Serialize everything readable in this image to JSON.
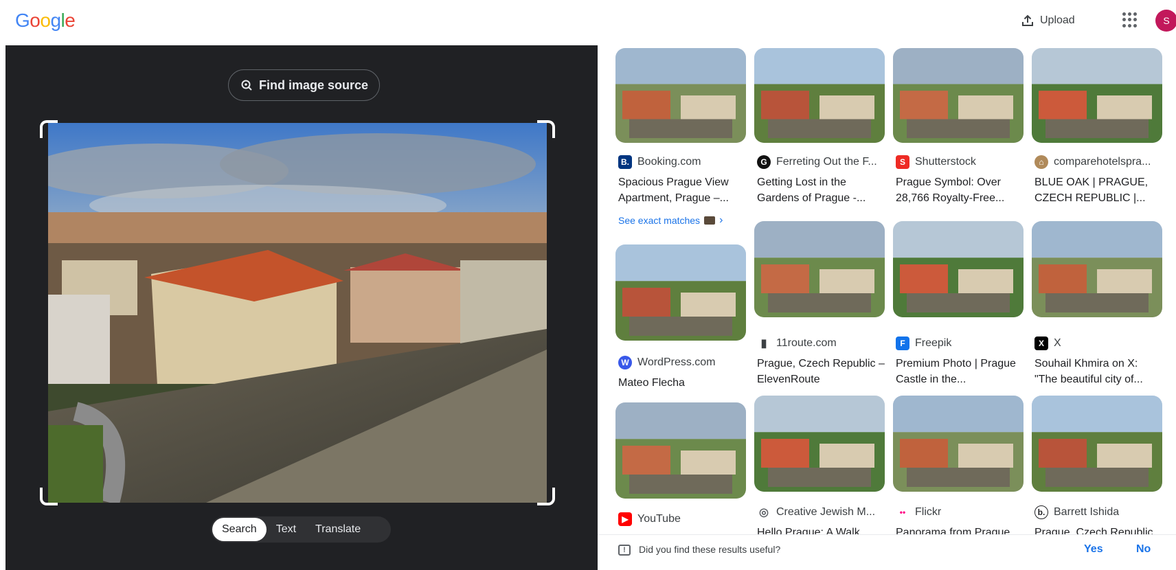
{
  "header": {
    "logo": [
      "G",
      "o",
      "o",
      "g",
      "l",
      "e"
    ],
    "logo_colors": [
      "#4285f4",
      "#ea4335",
      "#fbbc05",
      "#4285f4",
      "#34a853",
      "#ea4335"
    ],
    "upload_label": "Upload",
    "avatar_letter": "S",
    "avatar_color": "#c2185b"
  },
  "lens": {
    "find_source_label": "Find image source",
    "modes": [
      "Search",
      "Text",
      "Translate"
    ],
    "active_mode": "Search"
  },
  "results": {
    "see_exact_matches": "See exact matches",
    "columns": [
      [
        {
          "site": "Booking.com",
          "icon": "booking-icon",
          "icon_color": "#003580",
          "icon_text": "B.",
          "title": "Spacious Prague View Apartment, Prague –..."
        },
        {
          "site": "WordPress.com",
          "icon": "wordpress-icon",
          "icon_color": "#3858e9",
          "icon_text": "W",
          "title": "Mateo Flecha"
        },
        {
          "site": "YouTube",
          "icon": "youtube-icon",
          "icon_color": "#ff0000",
          "icon_text": "▶",
          "title": ""
        }
      ],
      [
        {
          "site": "Ferreting Out the F...",
          "icon": "ferreting-icon",
          "icon_color": "#111111",
          "icon_text": "G",
          "title": "Getting Lost in the Gardens of Prague -..."
        },
        {
          "site": "11route.com",
          "icon": "route-icon",
          "icon_color": "#3c4043",
          "icon_text": "▮",
          "title": "Prague, Czech Republic – ElevenRoute"
        },
        {
          "site": "Creative Jewish M...",
          "icon": "globe-icon",
          "icon_color": "#5f6368",
          "icon_text": "◎",
          "title": "Hello Prague: A Walk"
        }
      ],
      [
        {
          "site": "Shutterstock",
          "icon": "shutterstock-icon",
          "icon_color": "#ee2b24",
          "icon_text": "S",
          "title": "Prague Symbol: Over 28,766 Royalty-Free..."
        },
        {
          "site": "Freepik",
          "icon": "freepik-icon",
          "icon_color": "#1273eb",
          "icon_text": "F",
          "title": "Premium Photo | Prague Castle in the..."
        },
        {
          "site": "Flickr",
          "icon": "flickr-icon",
          "icon_color": "#0063dc",
          "icon_text": "••",
          "title": "Panorama from Prague"
        }
      ],
      [
        {
          "site": "comparehotelspra...",
          "icon": "comparehotels-icon",
          "icon_color": "#b08a5a",
          "icon_text": "⌂",
          "title": "BLUE OAK | PRAGUE, CZECH REPUBLIC |..."
        },
        {
          "site": "X",
          "icon": "x-icon",
          "icon_color": "#000000",
          "icon_text": "X",
          "title": "Souhail Khmira on X: \"The beautiful city of..."
        },
        {
          "site": "Barrett Ishida",
          "icon": "barrett-icon",
          "icon_color": "#ffffff",
          "icon_text": "b.",
          "title": "Prague, Czech Republic"
        }
      ]
    ]
  },
  "feedback": {
    "question": "Did you find these results useful?",
    "yes": "Yes",
    "no": "No"
  }
}
